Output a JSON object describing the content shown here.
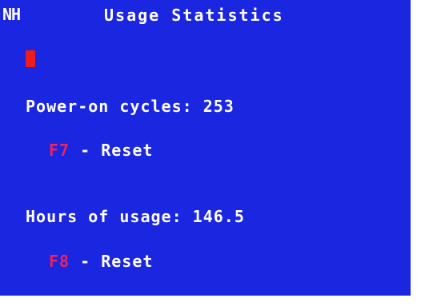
{
  "brand": {
    "logo_text": "NH"
  },
  "header": {
    "title": "Usage Statistics"
  },
  "stats": {
    "power_on": {
      "label": "Power-on cycles:",
      "value": "253",
      "reset_key": "F7",
      "reset_label": "- Reset"
    },
    "hours": {
      "label": "Hours of usage:",
      "value": "146.5",
      "reset_key": "F8",
      "reset_label": "- Reset"
    }
  },
  "colors": {
    "background": "#1a26e0",
    "text": "#ffffff",
    "key_accent": "#f0225a",
    "cursor": "#ef1c1c"
  }
}
